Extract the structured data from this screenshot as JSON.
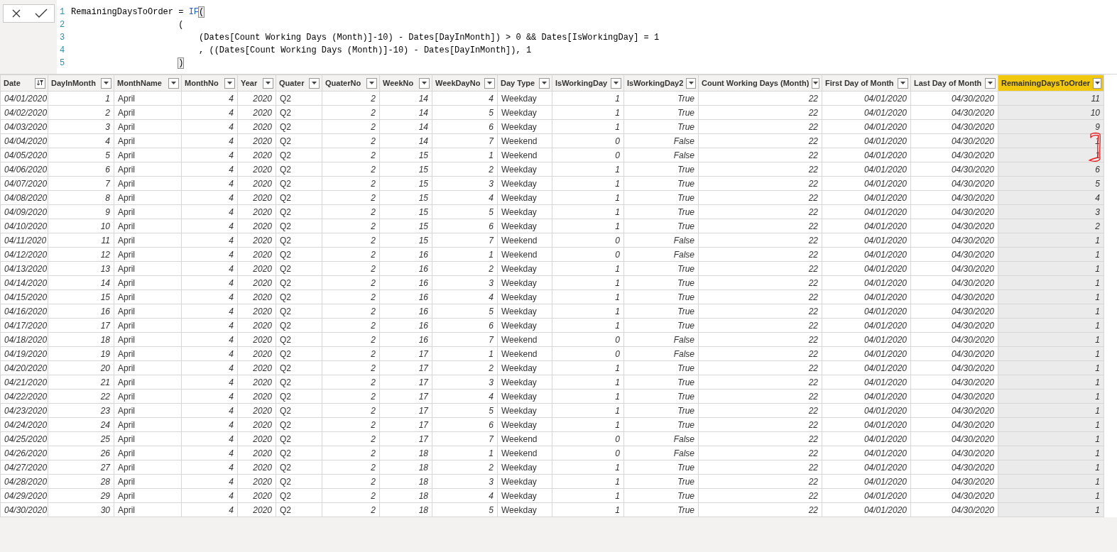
{
  "formula_bar": {
    "lines": [
      {
        "number": "1",
        "segments": [
          {
            "kind": "plain",
            "text": "RemainingDaysToOrder = "
          },
          {
            "kind": "keyword",
            "text": "IF"
          },
          {
            "kind": "bracket",
            "text": "("
          }
        ]
      },
      {
        "number": "2",
        "segments": [
          {
            "kind": "plain",
            "text": "                     ("
          }
        ]
      },
      {
        "number": "3",
        "segments": [
          {
            "kind": "plain",
            "text": "                         (Dates[Count Working Days (Month)]-10) - Dates[DayInMonth]) > 0 && Dates[IsWorkingDay] = 1"
          }
        ]
      },
      {
        "number": "4",
        "segments": [
          {
            "kind": "plain",
            "text": "                         , ((Dates[Count Working Days (Month)]-10) - Dates[DayInMonth]), 1"
          }
        ]
      },
      {
        "number": "5",
        "segments": [
          {
            "kind": "bracket",
            "text": "                     )"
          }
        ]
      }
    ]
  },
  "table": {
    "columns": [
      {
        "label": "Date",
        "kind": "date",
        "filtered": true,
        "selected": false
      },
      {
        "label": "DayInMonth",
        "kind": "number",
        "filtered": false,
        "selected": false
      },
      {
        "label": "MonthName",
        "kind": "text",
        "filtered": false,
        "selected": false
      },
      {
        "label": "MonthNo",
        "kind": "number",
        "filtered": false,
        "selected": false
      },
      {
        "label": "Year",
        "kind": "number",
        "filtered": false,
        "selected": false
      },
      {
        "label": "Quater",
        "kind": "text",
        "filtered": false,
        "selected": false
      },
      {
        "label": "QuaterNo",
        "kind": "number",
        "filtered": false,
        "selected": false
      },
      {
        "label": "WeekNo",
        "kind": "number",
        "filtered": false,
        "selected": false
      },
      {
        "label": "WeekDayNo",
        "kind": "number",
        "filtered": false,
        "selected": false
      },
      {
        "label": "Day Type",
        "kind": "text",
        "filtered": false,
        "selected": false
      },
      {
        "label": "IsWorkingDay",
        "kind": "number",
        "filtered": false,
        "selected": false
      },
      {
        "label": "IsWorkingDay2",
        "kind": "number",
        "filtered": false,
        "selected": false
      },
      {
        "label": "Count Working Days (Month)",
        "kind": "number",
        "filtered": false,
        "selected": false
      },
      {
        "label": "First Day of Month",
        "kind": "number",
        "filtered": false,
        "selected": false
      },
      {
        "label": "Last Day of Month",
        "kind": "number",
        "filtered": false,
        "selected": false
      },
      {
        "label": "RemainingDaysToOrder",
        "kind": "number",
        "filtered": false,
        "selected": true
      }
    ],
    "rows": [
      [
        "04/01/2020",
        "1",
        "April",
        "4",
        "2020",
        "Q2",
        "2",
        "14",
        "4",
        "Weekday",
        "1",
        "True",
        "22",
        "04/01/2020",
        "04/30/2020",
        "11"
      ],
      [
        "04/02/2020",
        "2",
        "April",
        "4",
        "2020",
        "Q2",
        "2",
        "14",
        "5",
        "Weekday",
        "1",
        "True",
        "22",
        "04/01/2020",
        "04/30/2020",
        "10"
      ],
      [
        "04/03/2020",
        "3",
        "April",
        "4",
        "2020",
        "Q2",
        "2",
        "14",
        "6",
        "Weekday",
        "1",
        "True",
        "22",
        "04/01/2020",
        "04/30/2020",
        "9"
      ],
      [
        "04/04/2020",
        "4",
        "April",
        "4",
        "2020",
        "Q2",
        "2",
        "14",
        "7",
        "Weekend",
        "0",
        "False",
        "22",
        "04/01/2020",
        "04/30/2020",
        "1"
      ],
      [
        "04/05/2020",
        "5",
        "April",
        "4",
        "2020",
        "Q2",
        "2",
        "15",
        "1",
        "Weekend",
        "0",
        "False",
        "22",
        "04/01/2020",
        "04/30/2020",
        "1"
      ],
      [
        "04/06/2020",
        "6",
        "April",
        "4",
        "2020",
        "Q2",
        "2",
        "15",
        "2",
        "Weekday",
        "1",
        "True",
        "22",
        "04/01/2020",
        "04/30/2020",
        "6"
      ],
      [
        "04/07/2020",
        "7",
        "April",
        "4",
        "2020",
        "Q2",
        "2",
        "15",
        "3",
        "Weekday",
        "1",
        "True",
        "22",
        "04/01/2020",
        "04/30/2020",
        "5"
      ],
      [
        "04/08/2020",
        "8",
        "April",
        "4",
        "2020",
        "Q2",
        "2",
        "15",
        "4",
        "Weekday",
        "1",
        "True",
        "22",
        "04/01/2020",
        "04/30/2020",
        "4"
      ],
      [
        "04/09/2020",
        "9",
        "April",
        "4",
        "2020",
        "Q2",
        "2",
        "15",
        "5",
        "Weekday",
        "1",
        "True",
        "22",
        "04/01/2020",
        "04/30/2020",
        "3"
      ],
      [
        "04/10/2020",
        "10",
        "April",
        "4",
        "2020",
        "Q2",
        "2",
        "15",
        "6",
        "Weekday",
        "1",
        "True",
        "22",
        "04/01/2020",
        "04/30/2020",
        "2"
      ],
      [
        "04/11/2020",
        "11",
        "April",
        "4",
        "2020",
        "Q2",
        "2",
        "15",
        "7",
        "Weekend",
        "0",
        "False",
        "22",
        "04/01/2020",
        "04/30/2020",
        "1"
      ],
      [
        "04/12/2020",
        "12",
        "April",
        "4",
        "2020",
        "Q2",
        "2",
        "16",
        "1",
        "Weekend",
        "0",
        "False",
        "22",
        "04/01/2020",
        "04/30/2020",
        "1"
      ],
      [
        "04/13/2020",
        "13",
        "April",
        "4",
        "2020",
        "Q2",
        "2",
        "16",
        "2",
        "Weekday",
        "1",
        "True",
        "22",
        "04/01/2020",
        "04/30/2020",
        "1"
      ],
      [
        "04/14/2020",
        "14",
        "April",
        "4",
        "2020",
        "Q2",
        "2",
        "16",
        "3",
        "Weekday",
        "1",
        "True",
        "22",
        "04/01/2020",
        "04/30/2020",
        "1"
      ],
      [
        "04/15/2020",
        "15",
        "April",
        "4",
        "2020",
        "Q2",
        "2",
        "16",
        "4",
        "Weekday",
        "1",
        "True",
        "22",
        "04/01/2020",
        "04/30/2020",
        "1"
      ],
      [
        "04/16/2020",
        "16",
        "April",
        "4",
        "2020",
        "Q2",
        "2",
        "16",
        "5",
        "Weekday",
        "1",
        "True",
        "22",
        "04/01/2020",
        "04/30/2020",
        "1"
      ],
      [
        "04/17/2020",
        "17",
        "April",
        "4",
        "2020",
        "Q2",
        "2",
        "16",
        "6",
        "Weekday",
        "1",
        "True",
        "22",
        "04/01/2020",
        "04/30/2020",
        "1"
      ],
      [
        "04/18/2020",
        "18",
        "April",
        "4",
        "2020",
        "Q2",
        "2",
        "16",
        "7",
        "Weekend",
        "0",
        "False",
        "22",
        "04/01/2020",
        "04/30/2020",
        "1"
      ],
      [
        "04/19/2020",
        "19",
        "April",
        "4",
        "2020",
        "Q2",
        "2",
        "17",
        "1",
        "Weekend",
        "0",
        "False",
        "22",
        "04/01/2020",
        "04/30/2020",
        "1"
      ],
      [
        "04/20/2020",
        "20",
        "April",
        "4",
        "2020",
        "Q2",
        "2",
        "17",
        "2",
        "Weekday",
        "1",
        "True",
        "22",
        "04/01/2020",
        "04/30/2020",
        "1"
      ],
      [
        "04/21/2020",
        "21",
        "April",
        "4",
        "2020",
        "Q2",
        "2",
        "17",
        "3",
        "Weekday",
        "1",
        "True",
        "22",
        "04/01/2020",
        "04/30/2020",
        "1"
      ],
      [
        "04/22/2020",
        "22",
        "April",
        "4",
        "2020",
        "Q2",
        "2",
        "17",
        "4",
        "Weekday",
        "1",
        "True",
        "22",
        "04/01/2020",
        "04/30/2020",
        "1"
      ],
      [
        "04/23/2020",
        "23",
        "April",
        "4",
        "2020",
        "Q2",
        "2",
        "17",
        "5",
        "Weekday",
        "1",
        "True",
        "22",
        "04/01/2020",
        "04/30/2020",
        "1"
      ],
      [
        "04/24/2020",
        "24",
        "April",
        "4",
        "2020",
        "Q2",
        "2",
        "17",
        "6",
        "Weekday",
        "1",
        "True",
        "22",
        "04/01/2020",
        "04/30/2020",
        "1"
      ],
      [
        "04/25/2020",
        "25",
        "April",
        "4",
        "2020",
        "Q2",
        "2",
        "17",
        "7",
        "Weekend",
        "0",
        "False",
        "22",
        "04/01/2020",
        "04/30/2020",
        "1"
      ],
      [
        "04/26/2020",
        "26",
        "April",
        "4",
        "2020",
        "Q2",
        "2",
        "18",
        "1",
        "Weekend",
        "0",
        "False",
        "22",
        "04/01/2020",
        "04/30/2020",
        "1"
      ],
      [
        "04/27/2020",
        "27",
        "April",
        "4",
        "2020",
        "Q2",
        "2",
        "18",
        "2",
        "Weekday",
        "1",
        "True",
        "22",
        "04/01/2020",
        "04/30/2020",
        "1"
      ],
      [
        "04/28/2020",
        "28",
        "April",
        "4",
        "2020",
        "Q2",
        "2",
        "18",
        "3",
        "Weekday",
        "1",
        "True",
        "22",
        "04/01/2020",
        "04/30/2020",
        "1"
      ],
      [
        "04/29/2020",
        "29",
        "April",
        "4",
        "2020",
        "Q2",
        "2",
        "18",
        "4",
        "Weekday",
        "1",
        "True",
        "22",
        "04/01/2020",
        "04/30/2020",
        "1"
      ],
      [
        "04/30/2020",
        "30",
        "April",
        "4",
        "2020",
        "Q2",
        "2",
        "18",
        "5",
        "Weekday",
        "1",
        "True",
        "22",
        "04/01/2020",
        "04/30/2020",
        "1"
      ]
    ]
  }
}
